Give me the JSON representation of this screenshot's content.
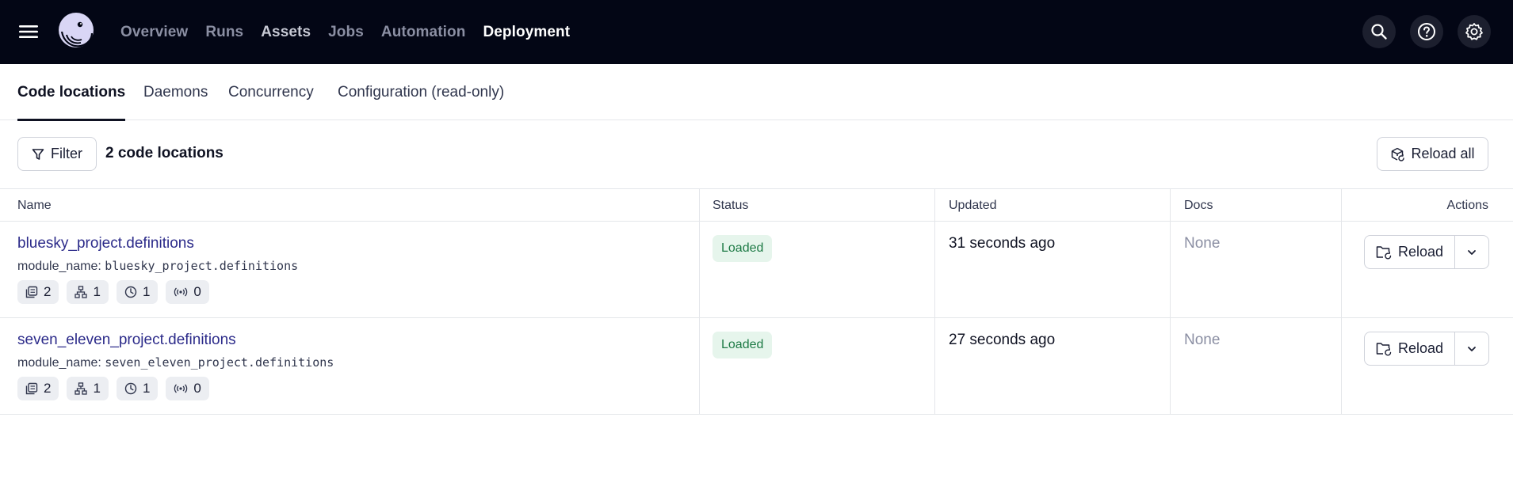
{
  "colors": {
    "topbar": "#030615",
    "link": "#2c2b8a",
    "status_loaded_bg": "#e6f5ec",
    "status_loaded_text": "#1d7a45"
  },
  "topbar": {
    "nav": [
      {
        "label": "Overview",
        "active": false
      },
      {
        "label": "Runs",
        "active": false
      },
      {
        "label": "Assets",
        "active": false
      },
      {
        "label": "Jobs",
        "active": false
      },
      {
        "label": "Automation",
        "active": false
      },
      {
        "label": "Deployment",
        "active": true
      }
    ],
    "icons": [
      "search-icon",
      "help-icon",
      "gear-icon"
    ]
  },
  "tabs": [
    {
      "label": "Code locations",
      "active": true
    },
    {
      "label": "Daemons",
      "active": false
    },
    {
      "label": "Concurrency",
      "active": false
    },
    {
      "label": "Configuration (read-only)",
      "active": false
    }
  ],
  "toolbar": {
    "filter_label": "Filter",
    "count_label": "2 code locations",
    "reload_all_label": "Reload all"
  },
  "table": {
    "headers": {
      "name": "Name",
      "status": "Status",
      "updated": "Updated",
      "docs": "Docs",
      "actions": "Actions"
    },
    "rows": [
      {
        "name": "bluesky_project.definitions",
        "module_key": "module_name:",
        "module_value": "bluesky_project.definitions",
        "counts": {
          "assets": "2",
          "jobs": "1",
          "schedules": "1",
          "sensors": "0"
        },
        "status": "Loaded",
        "updated": "31 seconds ago",
        "docs": "None",
        "reload_label": "Reload"
      },
      {
        "name": "seven_eleven_project.definitions",
        "module_key": "module_name:",
        "module_value": "seven_eleven_project.definitions",
        "counts": {
          "assets": "2",
          "jobs": "1",
          "schedules": "1",
          "sensors": "0"
        },
        "status": "Loaded",
        "updated": "27 seconds ago",
        "docs": "None",
        "reload_label": "Reload"
      }
    ]
  }
}
